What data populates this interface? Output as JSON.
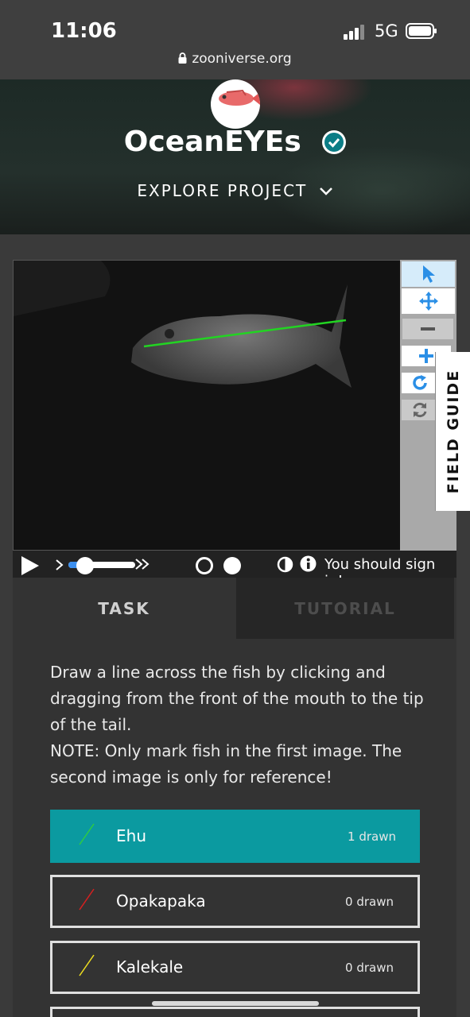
{
  "status_bar": {
    "time": "11:06",
    "network": "5G",
    "url": "zooniverse.org"
  },
  "project": {
    "title": "OceanEYEs",
    "explore_label": "EXPLORE PROJECT"
  },
  "viewer": {
    "field_guide_label": "FIELD GUIDE",
    "signin_message": "You should sign in!",
    "tools": [
      "pointer-icon",
      "move-icon",
      "zoom-out-icon",
      "zoom-in-icon",
      "rotate-icon",
      "reset-icon"
    ],
    "line_color": "#22d422"
  },
  "task_panel": {
    "tabs": [
      {
        "label": "TASK",
        "active": true
      },
      {
        "label": "TUTORIAL",
        "active": false
      }
    ],
    "instruction_line1": "Draw a line across the fish by clicking and dragging from the front of the mouth to the tip of the tail.",
    "instruction_line2": "NOTE: Only mark fish in the first image. The second image is only for reference!",
    "choices": [
      {
        "label": "Ehu",
        "count": "1 drawn",
        "color": "#2ecc40",
        "active": true
      },
      {
        "label": "Opakapaka",
        "count": "0 drawn",
        "color": "#d62020",
        "active": false
      },
      {
        "label": "Kalekale",
        "count": "0 drawn",
        "color": "#f0e020",
        "active": false
      }
    ]
  },
  "colors": {
    "accent": "#0b9aa0",
    "tool_blue": "#2b8fe6"
  }
}
